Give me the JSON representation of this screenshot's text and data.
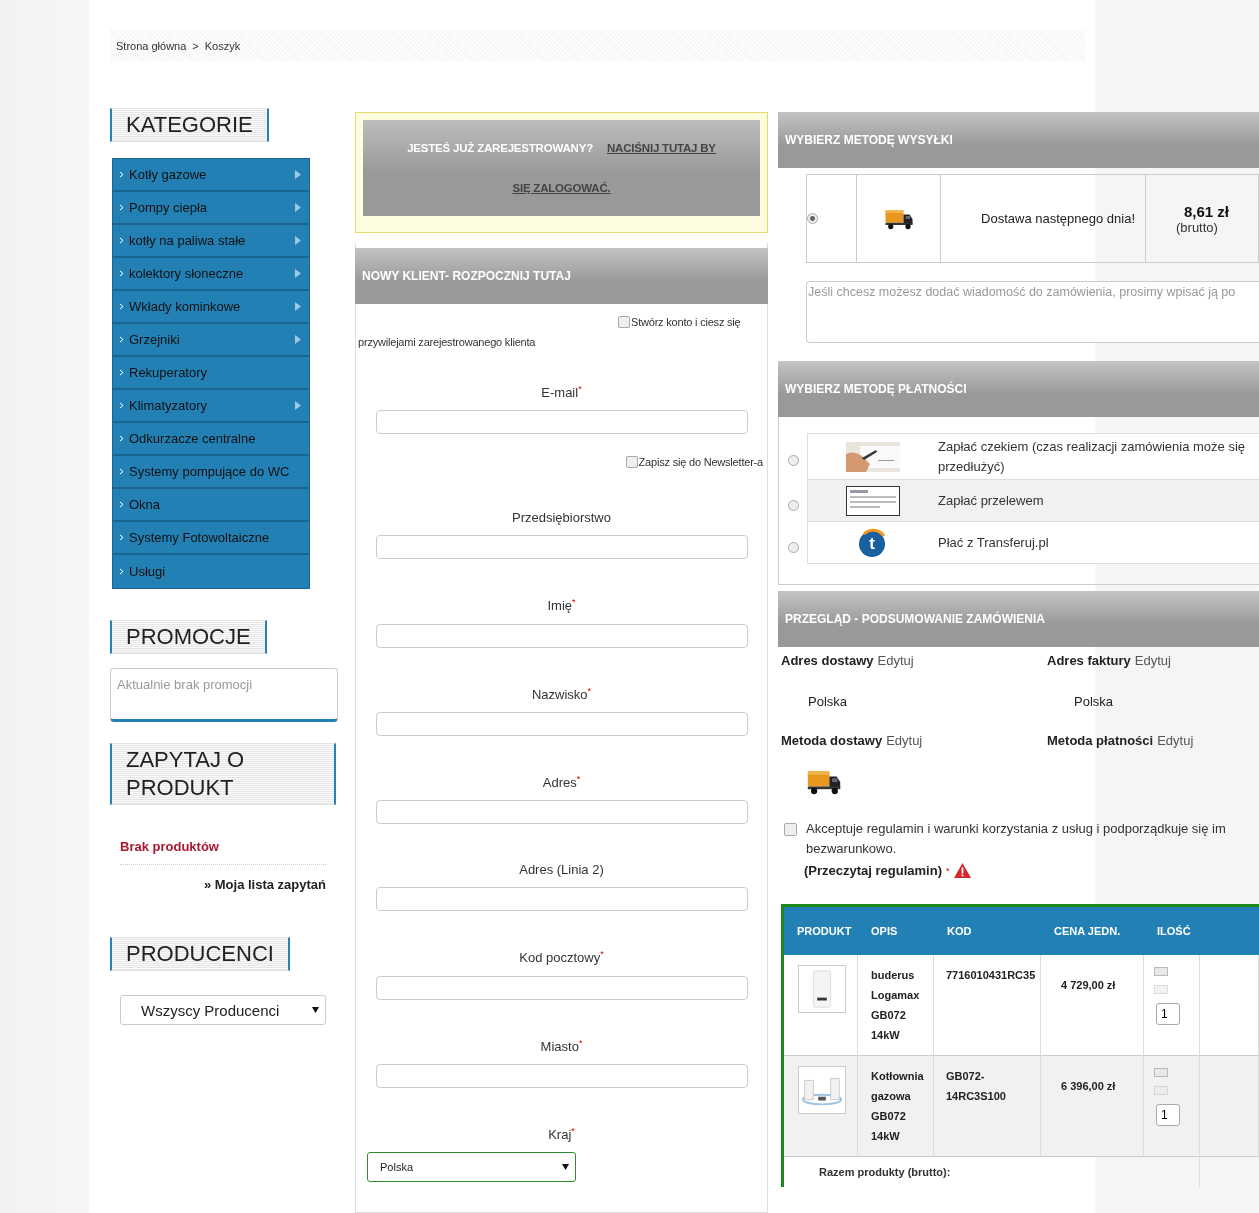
{
  "breadcrumb": {
    "items": [
      "Strona główna",
      "Koszyk"
    ],
    "separator": ">"
  },
  "sidebar": {
    "categories": {
      "title": "KATEGORIE",
      "items": [
        {
          "label": "Kotły gazowe",
          "has_submenu": true
        },
        {
          "label": "Pompy ciepła",
          "has_submenu": true
        },
        {
          "label": "kotły na paliwa stałe",
          "has_submenu": true
        },
        {
          "label": "kolektory słoneczne",
          "has_submenu": true
        },
        {
          "label": "Wkłady kominkowe",
          "has_submenu": true
        },
        {
          "label": "Grzejniki",
          "has_submenu": true
        },
        {
          "label": "Rekuperatory",
          "has_submenu": false
        },
        {
          "label": "Klimatyzatory",
          "has_submenu": true
        },
        {
          "label": "Odkurzacze centralne",
          "has_submenu": false
        },
        {
          "label": "Systemy pompujące do WC",
          "has_submenu": false
        },
        {
          "label": "Okna",
          "has_submenu": false
        },
        {
          "label": "Systemy Fotowoltaiczne",
          "has_submenu": false
        },
        {
          "label": "Usługi",
          "has_submenu": false
        }
      ]
    },
    "promotions": {
      "title": "PROMOCJE",
      "text": "Aktualnie brak promocji"
    },
    "inquiry": {
      "title": "ZAPYTAJ O PRODUKT",
      "empty_text": "Brak produktów",
      "link": "» Moja lista zapytań"
    },
    "producers": {
      "title": "PRODUCENCI",
      "select_value": "Wszyscy Producenci"
    }
  },
  "login_box": {
    "question": "JESTEŚ JUŻ ZAREJESTROWANY?",
    "link_lines": [
      "NACIŚNIJ TUTAJ BY",
      "SIĘ ZALOGOWAĆ."
    ]
  },
  "new_customer": {
    "title": "NOWY KLIENT- ROZPOCZNIJ TUTAJ",
    "required_mark": "*",
    "items": [
      {
        "kind": "checkbox",
        "label": "Stwórz konto i ciesz się przywilejami zarejestrowanego klienta",
        "checked": false
      },
      {
        "kind": "input",
        "label": "E-mail",
        "required": true
      },
      {
        "kind": "checkbox",
        "label": "Zapisz się do Newsletter-a",
        "checked": false
      },
      {
        "kind": "input",
        "label": "Przedsiębiorstwo",
        "required": false
      },
      {
        "kind": "input",
        "label": "Imię",
        "required": true
      },
      {
        "kind": "input",
        "label": "Nazwisko",
        "required": true
      },
      {
        "kind": "input",
        "label": "Adres",
        "required": true
      },
      {
        "kind": "input",
        "label": "Adres (Linia 2)",
        "required": false
      },
      {
        "kind": "input",
        "label": "Kod pocztowy",
        "required": true
      },
      {
        "kind": "input",
        "label": "Miasto",
        "required": true
      },
      {
        "kind": "select",
        "label": "Kraj",
        "required": true,
        "value": "Polska"
      }
    ]
  },
  "shipping": {
    "title": "WYBIERZ METODĘ WYSYŁKI",
    "options": [
      {
        "selected": true,
        "name": "Dostawa następnego dnia!",
        "price": "8,61 zł",
        "note": "(brutto)"
      }
    ],
    "message_placeholder": "Jeśli chcesz możesz dodać wiadomość do zamówienia, prosimy wpisać ją po"
  },
  "payment": {
    "title": "WYBIERZ METODĘ PŁATNOŚCI",
    "options": [
      {
        "kind": "cheque",
        "label": "Zapłać czekiem (czas realizacji zamówienia może się przedłużyć)",
        "selected": false,
        "highlighted": false
      },
      {
        "kind": "transfer",
        "label": "Zapłać przelewem",
        "selected": false,
        "highlighted": true
      },
      {
        "kind": "logo",
        "logo_letter": "t",
        "label": "Płać z Transferuj.pl",
        "selected": false,
        "highlighted": false
      }
    ]
  },
  "summary": {
    "title": "PRZEGLĄD - PODSUMOWANIE ZAMÓWIENIA",
    "blocks": [
      {
        "label": "Adres dostawy",
        "edit": "Edytuj",
        "value": "Polska"
      },
      {
        "label": "Adres faktury",
        "edit": "Edytuj",
        "value": "Polska"
      },
      {
        "label": "Metoda dostawy",
        "edit": "Edytuj",
        "kind": "truck"
      },
      {
        "label": "Metoda płatności",
        "edit": "Edytuj"
      }
    ],
    "terms": {
      "checked": false,
      "text": "Akceptuje regulamin i warunki korzystania z usług i podporządkuje się im bezwarunkowo.",
      "link": "(Przeczytaj regulamin)",
      "required_mark": "*"
    }
  },
  "cart": {
    "columns": [
      "PRODUKT",
      "OPIS",
      "KOD",
      "CENA JEDN.",
      "ILOŚĆ"
    ],
    "rows": [
      {
        "kind": "boiler",
        "description": "buderus Logamax GB072 14kW",
        "code": "7716010431RC35",
        "price": "4 729,00 zł",
        "quantity": "1"
      },
      {
        "kind": "set",
        "description": "Kotłownia gazowa GB072 14kW",
        "code": "GB072-14RC3S100",
        "price": "6 396,00 zł",
        "quantity": "1"
      }
    ],
    "total_label": "Razem produkty (brutto):"
  }
}
